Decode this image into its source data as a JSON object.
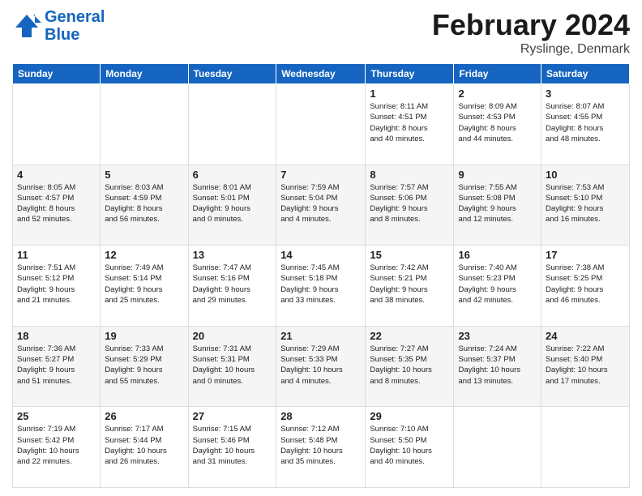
{
  "header": {
    "logo_line1": "General",
    "logo_line2": "Blue",
    "month_title": "February 2024",
    "location": "Ryslinge, Denmark"
  },
  "days_of_week": [
    "Sunday",
    "Monday",
    "Tuesday",
    "Wednesday",
    "Thursday",
    "Friday",
    "Saturday"
  ],
  "weeks": [
    [
      {
        "day": "",
        "info": ""
      },
      {
        "day": "",
        "info": ""
      },
      {
        "day": "",
        "info": ""
      },
      {
        "day": "",
        "info": ""
      },
      {
        "day": "1",
        "info": "Sunrise: 8:11 AM\nSunset: 4:51 PM\nDaylight: 8 hours\nand 40 minutes."
      },
      {
        "day": "2",
        "info": "Sunrise: 8:09 AM\nSunset: 4:53 PM\nDaylight: 8 hours\nand 44 minutes."
      },
      {
        "day": "3",
        "info": "Sunrise: 8:07 AM\nSunset: 4:55 PM\nDaylight: 8 hours\nand 48 minutes."
      }
    ],
    [
      {
        "day": "4",
        "info": "Sunrise: 8:05 AM\nSunset: 4:57 PM\nDaylight: 8 hours\nand 52 minutes."
      },
      {
        "day": "5",
        "info": "Sunrise: 8:03 AM\nSunset: 4:59 PM\nDaylight: 8 hours\nand 56 minutes."
      },
      {
        "day": "6",
        "info": "Sunrise: 8:01 AM\nSunset: 5:01 PM\nDaylight: 9 hours\nand 0 minutes."
      },
      {
        "day": "7",
        "info": "Sunrise: 7:59 AM\nSunset: 5:04 PM\nDaylight: 9 hours\nand 4 minutes."
      },
      {
        "day": "8",
        "info": "Sunrise: 7:57 AM\nSunset: 5:06 PM\nDaylight: 9 hours\nand 8 minutes."
      },
      {
        "day": "9",
        "info": "Sunrise: 7:55 AM\nSunset: 5:08 PM\nDaylight: 9 hours\nand 12 minutes."
      },
      {
        "day": "10",
        "info": "Sunrise: 7:53 AM\nSunset: 5:10 PM\nDaylight: 9 hours\nand 16 minutes."
      }
    ],
    [
      {
        "day": "11",
        "info": "Sunrise: 7:51 AM\nSunset: 5:12 PM\nDaylight: 9 hours\nand 21 minutes."
      },
      {
        "day": "12",
        "info": "Sunrise: 7:49 AM\nSunset: 5:14 PM\nDaylight: 9 hours\nand 25 minutes."
      },
      {
        "day": "13",
        "info": "Sunrise: 7:47 AM\nSunset: 5:16 PM\nDaylight: 9 hours\nand 29 minutes."
      },
      {
        "day": "14",
        "info": "Sunrise: 7:45 AM\nSunset: 5:18 PM\nDaylight: 9 hours\nand 33 minutes."
      },
      {
        "day": "15",
        "info": "Sunrise: 7:42 AM\nSunset: 5:21 PM\nDaylight: 9 hours\nand 38 minutes."
      },
      {
        "day": "16",
        "info": "Sunrise: 7:40 AM\nSunset: 5:23 PM\nDaylight: 9 hours\nand 42 minutes."
      },
      {
        "day": "17",
        "info": "Sunrise: 7:38 AM\nSunset: 5:25 PM\nDaylight: 9 hours\nand 46 minutes."
      }
    ],
    [
      {
        "day": "18",
        "info": "Sunrise: 7:36 AM\nSunset: 5:27 PM\nDaylight: 9 hours\nand 51 minutes."
      },
      {
        "day": "19",
        "info": "Sunrise: 7:33 AM\nSunset: 5:29 PM\nDaylight: 9 hours\nand 55 minutes."
      },
      {
        "day": "20",
        "info": "Sunrise: 7:31 AM\nSunset: 5:31 PM\nDaylight: 10 hours\nand 0 minutes."
      },
      {
        "day": "21",
        "info": "Sunrise: 7:29 AM\nSunset: 5:33 PM\nDaylight: 10 hours\nand 4 minutes."
      },
      {
        "day": "22",
        "info": "Sunrise: 7:27 AM\nSunset: 5:35 PM\nDaylight: 10 hours\nand 8 minutes."
      },
      {
        "day": "23",
        "info": "Sunrise: 7:24 AM\nSunset: 5:37 PM\nDaylight: 10 hours\nand 13 minutes."
      },
      {
        "day": "24",
        "info": "Sunrise: 7:22 AM\nSunset: 5:40 PM\nDaylight: 10 hours\nand 17 minutes."
      }
    ],
    [
      {
        "day": "25",
        "info": "Sunrise: 7:19 AM\nSunset: 5:42 PM\nDaylight: 10 hours\nand 22 minutes."
      },
      {
        "day": "26",
        "info": "Sunrise: 7:17 AM\nSunset: 5:44 PM\nDaylight: 10 hours\nand 26 minutes."
      },
      {
        "day": "27",
        "info": "Sunrise: 7:15 AM\nSunset: 5:46 PM\nDaylight: 10 hours\nand 31 minutes."
      },
      {
        "day": "28",
        "info": "Sunrise: 7:12 AM\nSunset: 5:48 PM\nDaylight: 10 hours\nand 35 minutes."
      },
      {
        "day": "29",
        "info": "Sunrise: 7:10 AM\nSunset: 5:50 PM\nDaylight: 10 hours\nand 40 minutes."
      },
      {
        "day": "",
        "info": ""
      },
      {
        "day": "",
        "info": ""
      }
    ]
  ]
}
